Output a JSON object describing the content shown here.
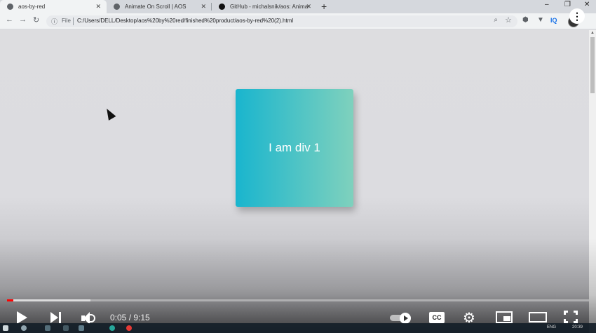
{
  "browser": {
    "tabs": [
      {
        "label": "aos-by-red",
        "active": true
      },
      {
        "label": "Animate On Scroll | AOS",
        "active": false
      },
      {
        "label": "GitHub - michalsnik/aos: Animat",
        "active": false
      }
    ],
    "new_tab_label": "+",
    "window_controls": {
      "minimize": "–",
      "restore": "❐",
      "close": "✕"
    },
    "nav": {
      "back": "←",
      "forward": "→",
      "reload": "↻"
    },
    "address": {
      "info_icon": "ⓘ",
      "scheme": "File",
      "url": "C:/Users/DELL/Desktop/aos%20by%20red/finished%20product/aos-by-red%20(2).html",
      "zoom_icon": "⌕",
      "bookmark_icon": "☆"
    },
    "extensions": {
      "ext1": "⬢",
      "ext2": "▼",
      "iq": "IQ"
    }
  },
  "page": {
    "div1_text": "I am div 1",
    "div1_colors": {
      "start": "#19b5ce",
      "end": "#7fd1bd"
    }
  },
  "player": {
    "more_icon": "⋮",
    "time": "0:05 / 9:15",
    "progress_played_fraction": 0.011,
    "progress_buffered_fraction": 0.143,
    "cc_label": "CC",
    "settings_icon": "⚙",
    "accent_color": "#ff0000"
  },
  "taskbar": {
    "lang": "ENG",
    "clock": "20:39"
  }
}
